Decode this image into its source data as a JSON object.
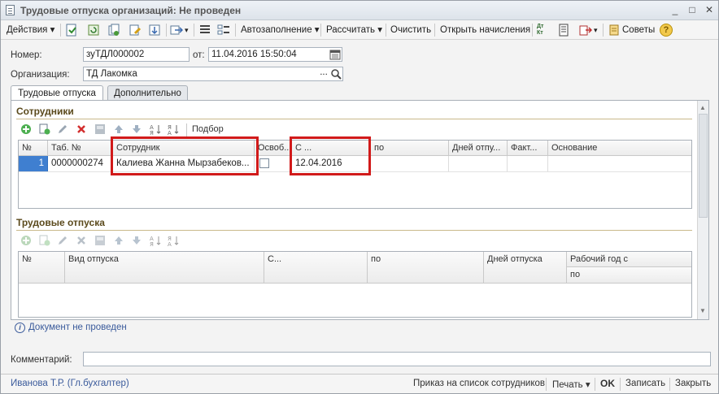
{
  "window": {
    "title": "Трудовые отпуска организаций: Не проведен",
    "minimize": "_",
    "maximize": "□",
    "close": "✕"
  },
  "toolbar": {
    "actions": "Действия",
    "autofill": "Автозаполнение",
    "calculate": "Рассчитать",
    "clear": "Очистить",
    "open_accruals": "Открыть начисления",
    "tips": "Советы",
    "help": "?",
    "dtkt": "Дт Кт"
  },
  "header": {
    "number_label": "Номер:",
    "number_value": "зуТДЛ000002",
    "date_label": "от:",
    "date_value": "11.04.2016 15:50:04",
    "org_label": "Организация:",
    "org_value": "ТД Лакомка",
    "select_btn": "...",
    "search_btn": "Q"
  },
  "tabs": [
    {
      "label": "Трудовые отпуска"
    },
    {
      "label": "Дополнительно"
    }
  ],
  "employees": {
    "title": "Сотрудники",
    "pick": "Подбор",
    "columns": [
      "№",
      "Таб. №",
      "Сотрудник",
      "Освоб...",
      "С ...",
      "по",
      "Дней отпу...",
      "Факт...",
      "Основание"
    ],
    "rows": [
      {
        "n": "1",
        "tab": "0000000274",
        "employee": "Калиева Жанна Мырзабеков...",
        "from": "12.04.2016",
        "to": "",
        "days": "",
        "fact": "",
        "reason": ""
      }
    ]
  },
  "leaves": {
    "title": "Трудовые отпуска",
    "columns": [
      "№",
      "Вид отпуска",
      "С...",
      "по",
      "Дней отпуска",
      "Рабочий год с",
      "по"
    ]
  },
  "info": {
    "text": "Документ не проведен",
    "icon": "i"
  },
  "comment": {
    "label": "Комментарий:",
    "value": ""
  },
  "footer": {
    "user": "Иванова Т.Р. (Гл.бухгалтер)",
    "order": "Приказ на список сотрудников",
    "print": "Печать",
    "ok": "OK",
    "save": "Записать",
    "close": "Закрыть"
  },
  "colors": {
    "highlight": "#d11a1a",
    "section": "#5b4a1c",
    "link": "#3a5a9b"
  }
}
